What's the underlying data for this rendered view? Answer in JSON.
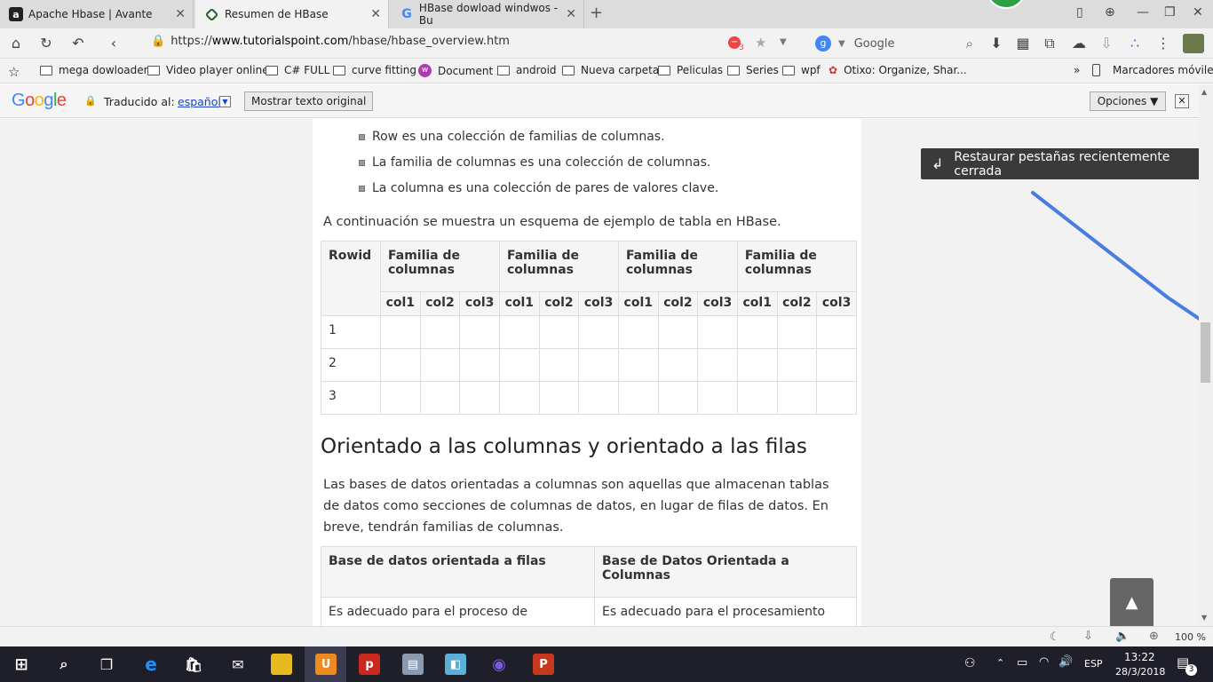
{
  "tabs": [
    {
      "title": "Apache Hbase | Avante",
      "icon": "a-icon"
    },
    {
      "title": "Resumen de HBase",
      "icon": "tp-icon"
    },
    {
      "title": "HBase dowload windwos - Bu",
      "icon": "google-icon"
    }
  ],
  "address": {
    "prefix": "https://",
    "domain": "www.tutorialspoint.com",
    "path": "/hbase/hbase_overview.htm",
    "badge_count": "3",
    "search_engine": "Google"
  },
  "bookmarks": [
    "mega dowloader",
    "Video player online",
    "C# FULL",
    "curve fitting",
    "Document",
    "android",
    "Nueva carpeta",
    "Peliculas",
    "Series",
    "wpf",
    "Otixo: Organize, Shar..."
  ],
  "bookmarks_more": "»",
  "bookmarks_mobile": "Marcadores móviles",
  "translate": {
    "label": "Traducido al:",
    "language": "español",
    "show_original": "Mostrar texto original",
    "options": "Opciones ▼",
    "close": "✕"
  },
  "article": {
    "bullets": [
      "Row es una colección de familias de columnas.",
      "La familia de columnas es una colección de columnas.",
      "La columna es una colección de pares de valores clave."
    ],
    "intro": "A continuación se muestra un esquema de ejemplo de tabla en HBase.",
    "table1": {
      "rowid_header": "Rowid",
      "family_headers": [
        "Familia de columnas",
        "Familia de columnas",
        "Familia de columnas",
        "Familia de columnas"
      ],
      "cols": [
        "col1",
        "col2",
        "col3"
      ],
      "rows": [
        "1",
        "2",
        "3"
      ]
    },
    "heading": "Orientado a las columnas y orientado a las filas",
    "para_lines": [
      "Las bases de datos orientadas a columnas son aquellas que almacenan tablas",
      "de datos como secciones de columnas de datos, en lugar de filas de datos. En",
      "breve, tendrán familias de columnas."
    ],
    "table2": {
      "headers": [
        "Base de datos orientada a filas",
        "Base de Datos Orientada a Columnas"
      ],
      "row1": [
        "Es adecuado para el proceso de",
        "Es adecuado para el procesamiento"
      ]
    }
  },
  "restore_tooltip": "Restaurar pestañas recientemente cerrada",
  "status": {
    "zoom": "100 %"
  },
  "taskbar": {
    "lang": "ESP",
    "time": "13:22",
    "date": "28/3/2018",
    "notifications": "3"
  }
}
